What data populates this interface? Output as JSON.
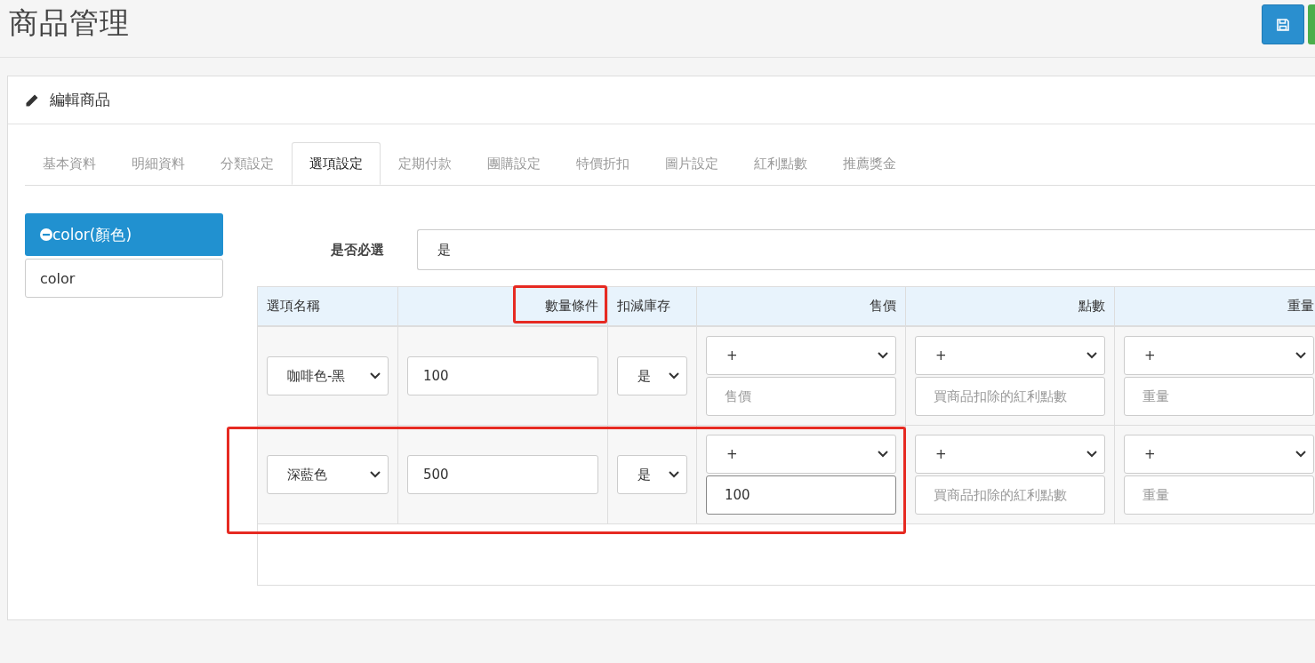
{
  "page": {
    "title": "商品管理"
  },
  "panel": {
    "title": "編輯商品"
  },
  "tabs": [
    {
      "label": "基本資料",
      "selected": false
    },
    {
      "label": "明細資料",
      "selected": false
    },
    {
      "label": "分類設定",
      "selected": false
    },
    {
      "label": "選項設定",
      "selected": true
    },
    {
      "label": "定期付款",
      "selected": false
    },
    {
      "label": "團購設定",
      "selected": false
    },
    {
      "label": "特價折扣",
      "selected": false
    },
    {
      "label": "圖片設定",
      "selected": false
    },
    {
      "label": "紅利點數",
      "selected": false
    },
    {
      "label": "推薦獎金",
      "selected": false
    }
  ],
  "option_groups": [
    {
      "label": "color(顏色)",
      "selected": true
    }
  ],
  "option_name": {
    "value": "color"
  },
  "required": {
    "label": "是否必選",
    "value": "是"
  },
  "table": {
    "columns": [
      {
        "label": "選項名稱",
        "annotated": false
      },
      {
        "label": "數量條件",
        "annotated": true
      },
      {
        "label": "扣減庫存",
        "annotated": false
      },
      {
        "label": "售價",
        "annotated": false
      },
      {
        "label": "點數",
        "annotated": false
      },
      {
        "label": "重量",
        "annotated": false
      }
    ],
    "rows": [
      {
        "annotated": false,
        "option": "咖啡色-黑",
        "quantity": "100",
        "deduct_stock": "是",
        "price": {
          "op": "+",
          "placeholder": "售價",
          "focused": false
        },
        "points": {
          "op": "+",
          "placeholder": "買商品扣除的紅利點數",
          "focused": false
        },
        "weight": {
          "op": "+",
          "placeholder": "重量",
          "focused": false
        }
      },
      {
        "annotated": true,
        "option": "深藍色",
        "quantity": "500",
        "deduct_stock": "是",
        "price": {
          "op": "+",
          "value": "100",
          "focused": true
        },
        "points": {
          "op": "+",
          "placeholder": "買商品扣除的紅利點數",
          "focused": false
        },
        "weight": {
          "op": "+",
          "placeholder": "重量",
          "focused": false
        }
      }
    ]
  }
}
